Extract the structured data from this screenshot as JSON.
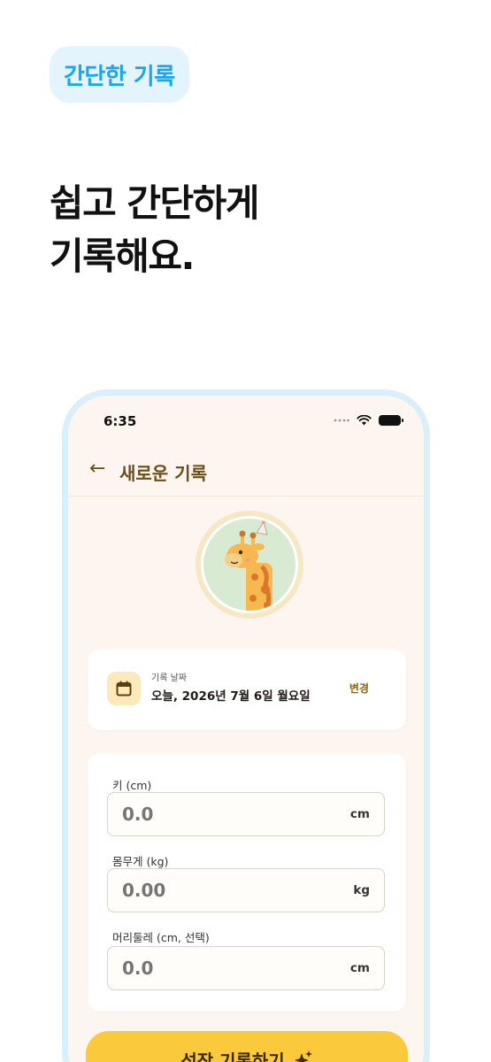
{
  "badge": {
    "label": "간단한 기록"
  },
  "headline": {
    "line1": "쉽고 간단하게",
    "line2": "기록해요."
  },
  "status_bar": {
    "time": "6:35",
    "icons": [
      "signal-dots-icon",
      "wifi-icon",
      "battery-icon"
    ]
  },
  "nav": {
    "back_icon": "arrow-left-icon",
    "title": "새로운 기록"
  },
  "avatar": {
    "icon": "giraffe-illustration"
  },
  "date_card": {
    "icon": "calendar-icon",
    "label": "기록 날짜",
    "value": "오늘, 2026년 7월 6일 월요일",
    "change_label": "변경"
  },
  "form": {
    "height": {
      "label": "키 (cm)",
      "placeholder": "0.0",
      "unit": "cm"
    },
    "weight": {
      "label": "몸무게 (kg)",
      "placeholder": "0.00",
      "unit": "kg"
    },
    "head": {
      "label": "머리둘레 (cm, 선택)",
      "placeholder": "0.0",
      "unit": "cm"
    }
  },
  "cta": {
    "label": "성장 기록하기",
    "icon": "sparkle-icon"
  },
  "colors": {
    "accent_blue": "#1aa6ea",
    "brand_brown": "#6b4d17",
    "cta_yellow": "#fbc93c",
    "app_bg": "#fdf6f0"
  }
}
